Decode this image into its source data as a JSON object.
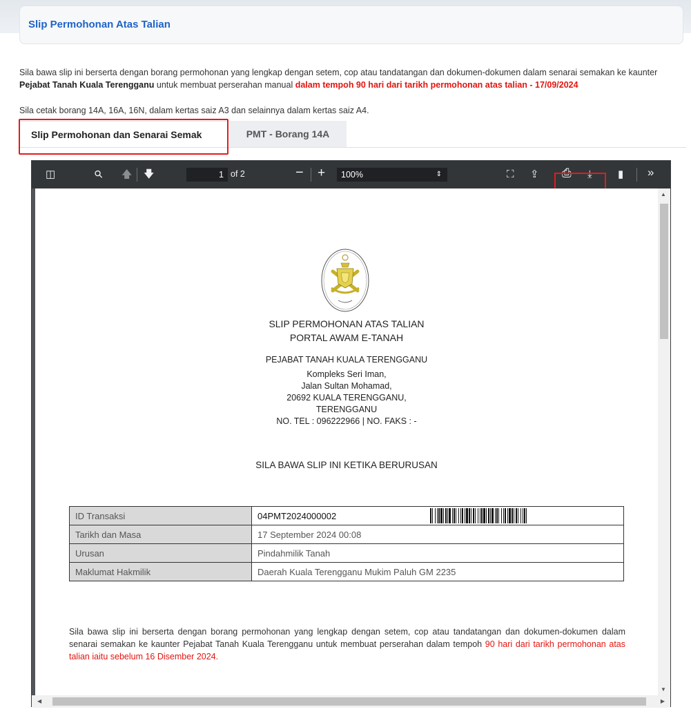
{
  "header": {
    "title": "Slip Permohonan Atas Talian"
  },
  "notice": {
    "text_before": "Sila bawa slip ini berserta dengan borang permohonan yang lengkap dengan setem, cop atau tandatangan dan dokumen-dokumen dalam senarai semakan ke kaunter ",
    "office_bold": "Pejabat Tanah Kuala Terengganu",
    "text_middle": " untuk membuat perserahan manual ",
    "deadline_red": "dalam tempoh 90 hari dari tarikh permohonan atas talian - 17/09/2024",
    "paper_note": "Sila cetak borang 14A, 16A, 16N, dalam kertas saiz A3 dan selainnya dalam kertas saiz A4."
  },
  "tabs": [
    {
      "label": "Slip Permohonan dan Senarai Semak",
      "active": true
    },
    {
      "label": "PMT - Borang 14A",
      "active": false
    }
  ],
  "viewer": {
    "page_current": "1",
    "page_total": "of 2",
    "zoom": "100%",
    "icons": {
      "sidebar": "sidebar-toggle-icon",
      "find": "search-icon",
      "prev": "arrow-up-icon",
      "next": "arrow-down-icon",
      "zoom_out": "minus-icon",
      "zoom_in": "plus-icon",
      "presentation": "fullscreen-icon",
      "open": "open-file-icon",
      "print": "printer-icon",
      "download": "download-icon",
      "bookmark": "bookmark-icon",
      "more": "double-chevron-right-icon"
    },
    "glyphs": {
      "sidebar": "◫",
      "find": "⚲",
      "prev": "🡅",
      "next": "🡇",
      "zoom_out": "−",
      "zoom_in": "+",
      "presentation": "⛶",
      "open": "⇪",
      "print": "⎙",
      "download": "⤓",
      "bookmark": "▮",
      "more": "»",
      "select_arrow": "⇕"
    }
  },
  "document": {
    "title_line1": "SLIP PERMOHONAN ATAS TALIAN",
    "title_line2": "PORTAL AWAM E-TANAH",
    "office_name": "PEJABAT TANAH KUALA TERENGGANU",
    "address_1": "Kompleks Seri Iman,",
    "address_2": "Jalan Sultan Mohamad,",
    "address_3": "20692 KUALA TERENGGANU,",
    "address_4": "TERENGGANU",
    "contact": "NO. TEL : 096222966 | NO. FAKS : -",
    "instruction": "SILA BAWA SLIP INI KETIKA BERURUSAN",
    "rows": [
      {
        "label": "ID Transaksi",
        "value": "04PMT2024000002"
      },
      {
        "label": "Tarikh dan Masa",
        "value": "17 September 2024 00:08"
      },
      {
        "label": "Urusan",
        "value": "Pindahmilik Tanah"
      },
      {
        "label": "Maklumat Hakmilik",
        "value": "Daerah Kuala Terengganu Mukim Paluh GM 2235"
      }
    ],
    "footer_text": "Sila bawa slip ini berserta dengan borang permohonan yang lengkap dengan setem, cop atau tandatangan dan dokumen-dokumen dalam senarai semakan ke kaunter Pejabat Tanah Kuala Terengganu untuk membuat perserahan dalam tempoh ",
    "footer_red": "90 hari dari tarikh permohonan atas talian iaitu sebelum 16 Disember 2024."
  },
  "colors": {
    "accent_blue": "#1e63c8",
    "highlight_red": "#e31b1b",
    "deadline_red": "#e3140f",
    "toolbar": "#323639"
  }
}
